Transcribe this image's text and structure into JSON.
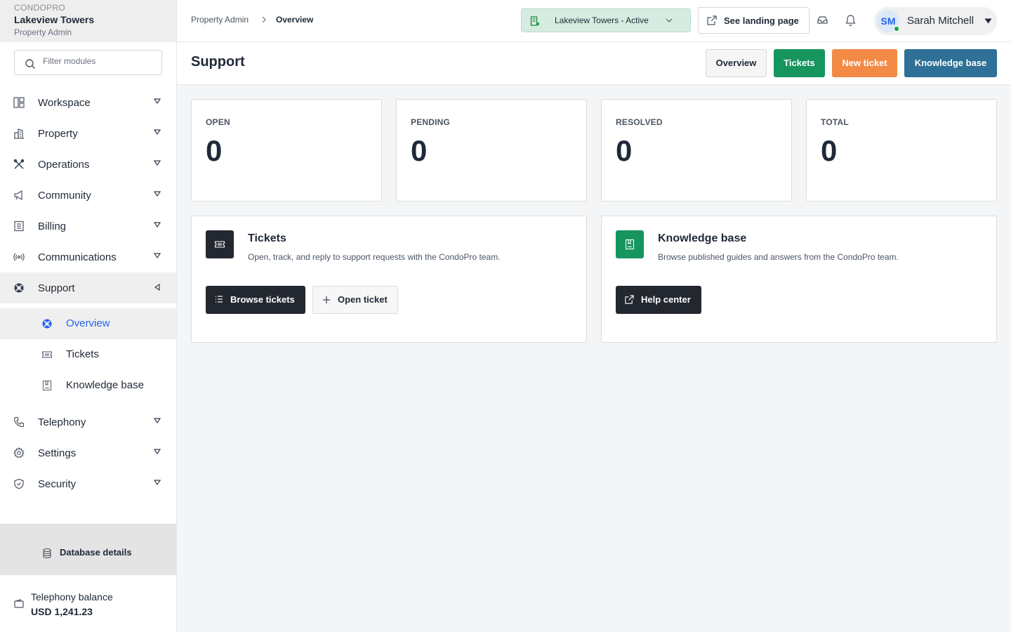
{
  "brand": {
    "kicker": "CONDOPRO",
    "name": "Lakeview Towers",
    "role": "Property Admin"
  },
  "sidebar": {
    "filter_placeholder": "Filter modules",
    "items": [
      {
        "label": "Workspace",
        "icon": "workspace-icon"
      },
      {
        "label": "Property",
        "icon": "building-icon"
      },
      {
        "label": "Operations",
        "icon": "tools-icon"
      },
      {
        "label": "Community",
        "icon": "megaphone-icon"
      },
      {
        "label": "Billing",
        "icon": "receipt-icon"
      },
      {
        "label": "Communications",
        "icon": "broadcast-icon"
      },
      {
        "label": "Support",
        "icon": "lifebuoy-icon"
      },
      {
        "label": "Telephony",
        "icon": "phone-icon"
      },
      {
        "label": "Settings",
        "icon": "gear-icon"
      },
      {
        "label": "Security",
        "icon": "shield-icon"
      }
    ],
    "support_children": [
      {
        "label": "Overview",
        "icon": "lifebuoy-icon"
      },
      {
        "label": "Tickets",
        "icon": "ticket-icon"
      },
      {
        "label": "Knowledge base",
        "icon": "book-icon"
      }
    ],
    "database_label": "Database details",
    "balance_label": "Telephony balance",
    "balance_value": "USD 1,241.23"
  },
  "topbar": {
    "breadcrumb_parent": "Property Admin",
    "breadcrumb_current": "Overview",
    "property_select": "Lakeview Towers - Active",
    "landing_label": "See landing page",
    "user_initials": "SM",
    "user_name": "Sarah Mitchell"
  },
  "header": {
    "title": "Support",
    "buttons": {
      "overview": "Overview",
      "tickets": "Tickets",
      "new_ticket": "New ticket",
      "knowledge_base": "Knowledge base"
    }
  },
  "stats": [
    {
      "label": "OPEN",
      "value": "0"
    },
    {
      "label": "PENDING",
      "value": "0"
    },
    {
      "label": "RESOLVED",
      "value": "0"
    },
    {
      "label": "TOTAL",
      "value": "0"
    }
  ],
  "cards": {
    "tickets": {
      "title": "Tickets",
      "description": "Open, track, and reply to support requests with the CondoPro team.",
      "primary": "Browse tickets",
      "secondary": "Open ticket"
    },
    "kb": {
      "title": "Knowledge base",
      "description": "Browse published guides and answers from the CondoPro team.",
      "primary": "Help center"
    }
  },
  "colors": {
    "tickets": "#16955f",
    "new_ticket": "#f28a45",
    "knowledge_base": "#2e7096",
    "dark": "#23272f",
    "active_link": "#2563eb"
  }
}
